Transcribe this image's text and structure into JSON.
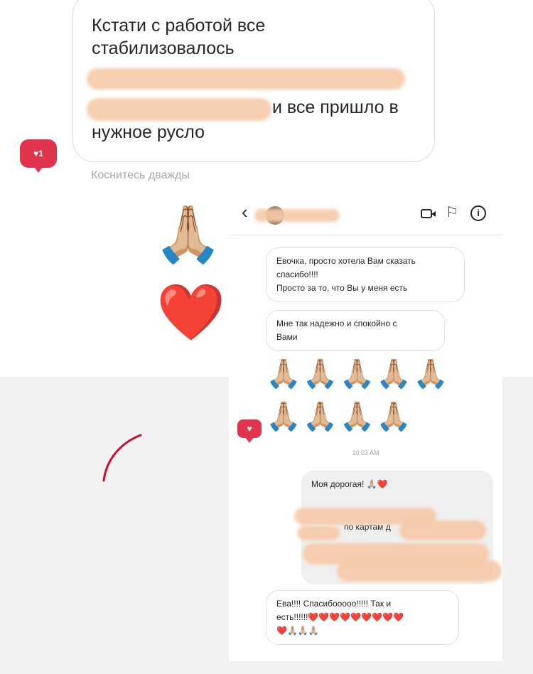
{
  "top_screen": {
    "message_lines": [
      "Кстати с работой все",
      "стабилизовалось",
      "и все пришло в",
      "нужное русло"
    ],
    "reaction_count": "1",
    "double_tap_hint": "Коснитесь дважды",
    "emojis": [
      "🙏🏼",
      "❤️"
    ]
  },
  "chat_screen": {
    "header": {
      "back_icon": "chevron-left-icon",
      "icons": [
        "video-icon",
        "flag-icon",
        "info-icon"
      ],
      "info_glyph": "i"
    },
    "incoming": [
      {
        "lines": [
          "Евочка, просто хотела Вам сказать",
          "спасибо!!!!",
          "Просто за то, что Вы у меня есть"
        ]
      },
      {
        "lines": [
          "Мне так надежно и спокойно с",
          "Вами"
        ]
      }
    ],
    "emoji_rows": [
      "🙏🏼🙏🏼🙏🏼🙏🏼🙏🏼",
      "🙏🏼🙏🏼🙏🏼🙏🏼"
    ],
    "timestamp": "10:03 AM",
    "outgoing": {
      "first_line": "Моя дорогая! 🙏🏼❤️",
      "partial_lines": [
        "по картам д"
      ]
    },
    "reply": {
      "lines": [
        "Ева!!!! Спасибооооо!!!!! Так и",
        "есть!!!!!!❤️❤️❤️❤️❤️❤️❤️❤️❤️",
        "❤️🙏🏼🙏🏼🙏🏼"
      ]
    }
  },
  "colors": {
    "reaction_badge": "#e0344f",
    "redaction": "#f6c9a8",
    "outgoing_bubble": "#efefef",
    "annotation_stroke": "#c8102e"
  }
}
